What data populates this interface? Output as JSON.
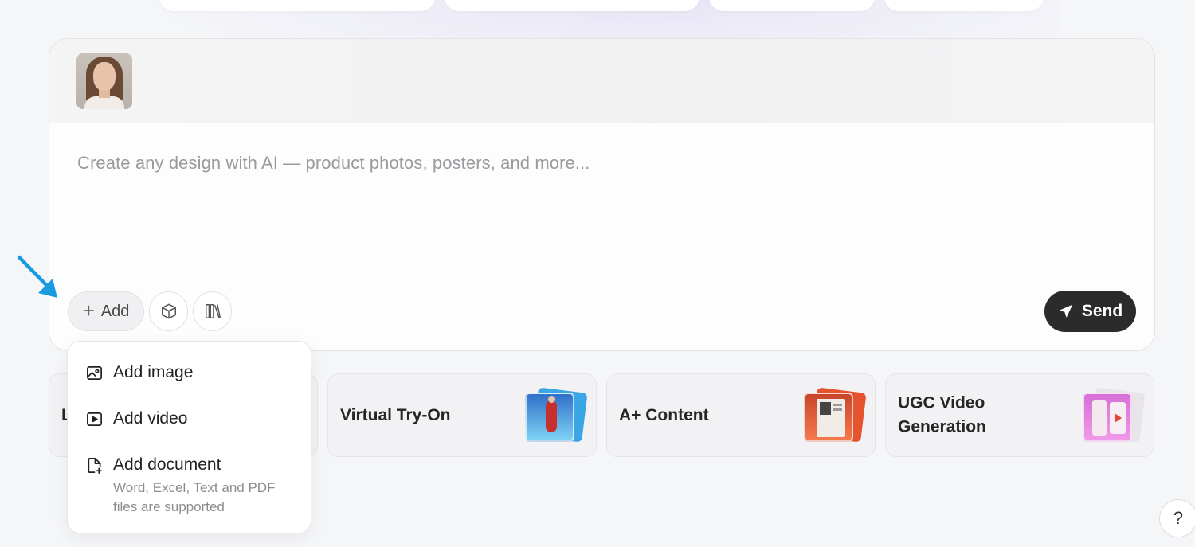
{
  "composer": {
    "prompt_placeholder": "Create any design with AI — product photos, posters, and more...",
    "add_label": "Add",
    "send_label": "Send"
  },
  "add_menu": {
    "items": [
      {
        "label": "Add image",
        "icon": "image-icon"
      },
      {
        "label": "Add video",
        "icon": "video-icon"
      },
      {
        "label": "Add document",
        "icon": "document-icon"
      }
    ],
    "document_hint": "Word, Excel, Text and PDF files are supported"
  },
  "feature_cards": [
    {
      "title": "L",
      "art_colors": []
    },
    {
      "title": "Virtual Try-On",
      "art_colors": [
        "#3aa6e6",
        "#7fd3f5"
      ]
    },
    {
      "title": "A+ Content",
      "art_colors": [
        "#e5532f",
        "#f47a4e"
      ]
    },
    {
      "title": "UGC Video Generation",
      "art_colors": [
        "#d66fd6",
        "#f09ae8"
      ]
    }
  ],
  "help_label": "?",
  "colors": {
    "accent_arrow": "#1a9be0",
    "send_bg": "#2b2b2c"
  }
}
